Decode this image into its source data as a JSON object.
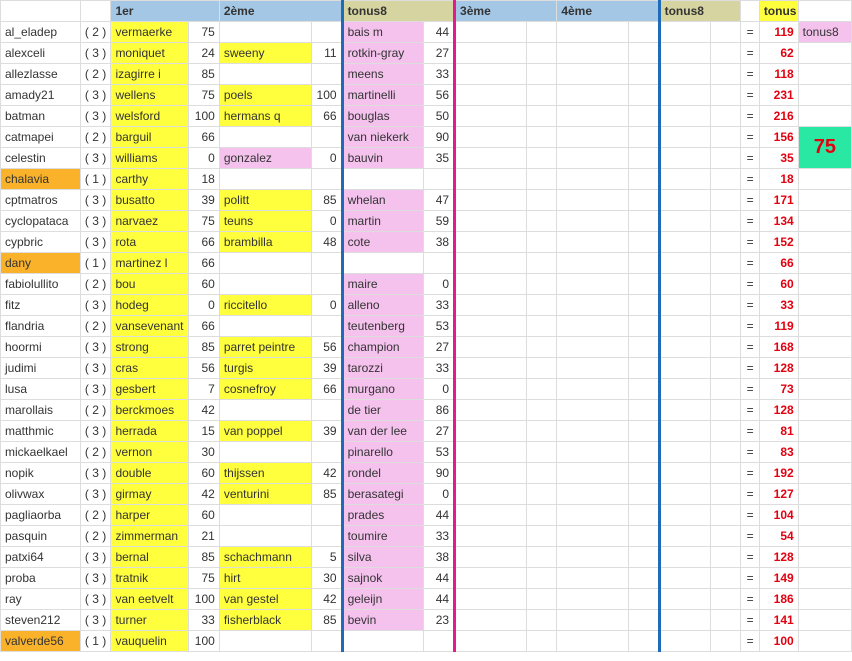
{
  "headers": {
    "col1": "1er",
    "col2": "2ème",
    "tonus_a": "tonus8",
    "col3": "3ème",
    "col4": "4ème",
    "tonus_b": "tonus8",
    "total_hdr": "tonus"
  },
  "side": {
    "label": "tonus8",
    "big_value": "75"
  },
  "rows": [
    {
      "name": "al_eladep",
      "par": "2",
      "p1n": "vermaerke",
      "p1v": "75",
      "p2n": "",
      "p2v": "",
      "t1n": "bais m",
      "t1v": "44",
      "tot": "119",
      "hl": ""
    },
    {
      "name": "alexceli",
      "par": "3",
      "p1n": "moniquet",
      "p1v": "24",
      "p2n": "sweeny",
      "p2v": "11",
      "t1n": "rotkin-gray",
      "t1v": "27",
      "tot": "62",
      "hl": ""
    },
    {
      "name": "allezlasse",
      "par": "2",
      "p1n": "izagirre i",
      "p1v": "85",
      "p2n": "",
      "p2v": "",
      "t1n": "meens",
      "t1v": "33",
      "tot": "118",
      "hl": ""
    },
    {
      "name": "amady21",
      "par": "3",
      "p1n": "wellens",
      "p1v": "75",
      "p2n": "poels",
      "p2v": "100",
      "t1n": "martinelli",
      "t1v": "56",
      "tot": "231",
      "hl": ""
    },
    {
      "name": "batman",
      "par": "3",
      "p1n": "welsford",
      "p1v": "100",
      "p2n": "hermans q",
      "p2v": "66",
      "t1n": "bouglas",
      "t1v": "50",
      "tot": "216",
      "hl": ""
    },
    {
      "name": "catmapei",
      "par": "2",
      "p1n": "barguil",
      "p1v": "66",
      "p2n": "",
      "p2v": "",
      "t1n": "van niekerk",
      "t1v": "90",
      "tot": "156",
      "hl": ""
    },
    {
      "name": "celestin",
      "par": "3",
      "p1n": "williams",
      "p1v": "0",
      "p2n": "gonzalez",
      "p2v": "0",
      "t1n": "bauvin",
      "t1v": "35",
      "tot": "35",
      "hl": "",
      "p2pink": true
    },
    {
      "name": "chalavia",
      "par": "1",
      "p1n": "carthy",
      "p1v": "18",
      "p2n": "",
      "p2v": "",
      "t1n": "",
      "t1v": "",
      "tot": "18",
      "hl": "orange"
    },
    {
      "name": "cptmatros",
      "par": "3",
      "p1n": "busatto",
      "p1v": "39",
      "p2n": "politt",
      "p2v": "85",
      "t1n": "whelan",
      "t1v": "47",
      "tot": "171",
      "hl": ""
    },
    {
      "name": "cyclopataca",
      "par": "3",
      "p1n": "narvaez",
      "p1v": "75",
      "p2n": "teuns",
      "p2v": "0",
      "t1n": "martin",
      "t1v": "59",
      "tot": "134",
      "hl": ""
    },
    {
      "name": "cypbric",
      "par": "3",
      "p1n": "rota",
      "p1v": "66",
      "p2n": "brambilla",
      "p2v": "48",
      "t1n": "cote",
      "t1v": "38",
      "tot": "152",
      "hl": ""
    },
    {
      "name": "dany",
      "par": "1",
      "p1n": "martinez l",
      "p1v": "66",
      "p2n": "",
      "p2v": "",
      "t1n": "",
      "t1v": "",
      "tot": "66",
      "hl": "orange"
    },
    {
      "name": "fabiolullito",
      "par": "2",
      "p1n": "bou",
      "p1v": "60",
      "p2n": "",
      "p2v": "",
      "t1n": "maire",
      "t1v": "0",
      "tot": "60",
      "hl": ""
    },
    {
      "name": "fitz",
      "par": "3",
      "p1n": "hodeg",
      "p1v": "0",
      "p2n": "riccitello",
      "p2v": "0",
      "t1n": "alleno",
      "t1v": "33",
      "tot": "33",
      "hl": ""
    },
    {
      "name": "flandria",
      "par": "2",
      "p1n": "vansevenant",
      "p1v": "66",
      "p2n": "",
      "p2v": "",
      "t1n": "teutenberg",
      "t1v": "53",
      "tot": "119",
      "hl": ""
    },
    {
      "name": "hoormi",
      "par": "3",
      "p1n": "strong",
      "p1v": "85",
      "p2n": "parret peintre",
      "p2v": "56",
      "t1n": "champion",
      "t1v": "27",
      "tot": "168",
      "hl": ""
    },
    {
      "name": "judimi",
      "par": "3",
      "p1n": "cras",
      "p1v": "56",
      "p2n": "turgis",
      "p2v": "39",
      "t1n": "tarozzi",
      "t1v": "33",
      "tot": "128",
      "hl": ""
    },
    {
      "name": "lusa",
      "par": "3",
      "p1n": "gesbert",
      "p1v": "7",
      "p2n": "cosnefroy",
      "p2v": "66",
      "t1n": "murgano",
      "t1v": "0",
      "tot": "73",
      "hl": ""
    },
    {
      "name": "marollais",
      "par": "2",
      "p1n": "berckmoes",
      "p1v": "42",
      "p2n": "",
      "p2v": "",
      "t1n": "de tier",
      "t1v": "86",
      "tot": "128",
      "hl": ""
    },
    {
      "name": "matthmic",
      "par": "3",
      "p1n": "herrada",
      "p1v": "15",
      "p2n": "van poppel",
      "p2v": "39",
      "t1n": "van der lee",
      "t1v": "27",
      "tot": "81",
      "hl": ""
    },
    {
      "name": "mickaelkael",
      "par": "2",
      "p1n": "vernon",
      "p1v": "30",
      "p2n": "",
      "p2v": "",
      "t1n": "pinarello",
      "t1v": "53",
      "tot": "83",
      "hl": ""
    },
    {
      "name": "nopik",
      "par": "3",
      "p1n": "double",
      "p1v": "60",
      "p2n": "thijssen",
      "p2v": "42",
      "t1n": "rondel",
      "t1v": "90",
      "tot": "192",
      "hl": ""
    },
    {
      "name": "olivwax",
      "par": "3",
      "p1n": "girmay",
      "p1v": "42",
      "p2n": "venturini",
      "p2v": "85",
      "t1n": "berasategi",
      "t1v": "0",
      "tot": "127",
      "hl": ""
    },
    {
      "name": "pagliaorba",
      "par": "2",
      "p1n": "harper",
      "p1v": "60",
      "p2n": "",
      "p2v": "",
      "t1n": "prades",
      "t1v": "44",
      "tot": "104",
      "hl": ""
    },
    {
      "name": "pasquin",
      "par": "2",
      "p1n": "zimmerman",
      "p1v": "21",
      "p2n": "",
      "p2v": "",
      "t1n": "toumire",
      "t1v": "33",
      "tot": "54",
      "hl": ""
    },
    {
      "name": "patxi64",
      "par": "3",
      "p1n": "bernal",
      "p1v": "85",
      "p2n": "schachmann",
      "p2v": "5",
      "t1n": "silva",
      "t1v": "38",
      "tot": "128",
      "hl": ""
    },
    {
      "name": "proba",
      "par": "3",
      "p1n": "tratnik",
      "p1v": "75",
      "p2n": "hirt",
      "p2v": "30",
      "t1n": "sajnok",
      "t1v": "44",
      "tot": "149",
      "hl": ""
    },
    {
      "name": "ray",
      "par": "3",
      "p1n": "van eetvelt",
      "p1v": "100",
      "p2n": "van gestel",
      "p2v": "42",
      "t1n": "geleijn",
      "t1v": "44",
      "tot": "186",
      "hl": ""
    },
    {
      "name": "steven212",
      "par": "3",
      "p1n": "turner",
      "p1v": "33",
      "p2n": "fisherblack",
      "p2v": "85",
      "t1n": "bevin",
      "t1v": "23",
      "tot": "141",
      "hl": ""
    },
    {
      "name": "valverde56",
      "par": "1",
      "p1n": "vauquelin",
      "p1v": "100",
      "p2n": "",
      "p2v": "",
      "t1n": "",
      "t1v": "",
      "tot": "100",
      "hl": "orange"
    }
  ]
}
